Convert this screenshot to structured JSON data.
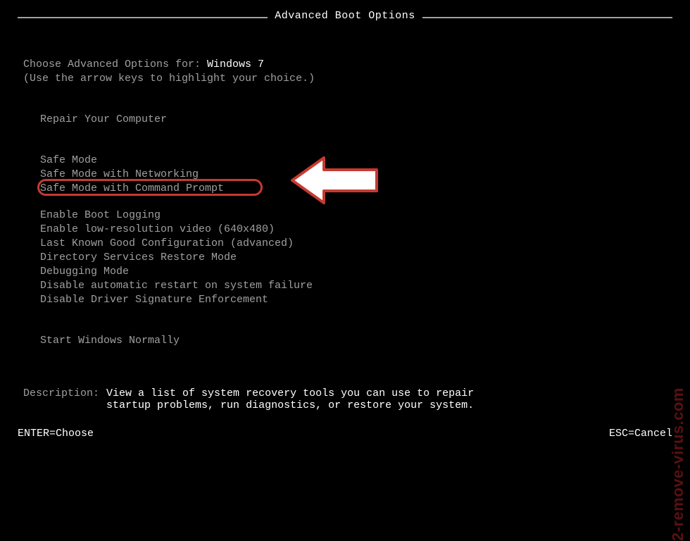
{
  "title": "Advanced Boot Options",
  "header": {
    "choose_label": "Choose Advanced Options for: ",
    "os_name": "Windows 7",
    "instructions": "(Use the arrow keys to highlight your choice.)"
  },
  "menu": {
    "repair": "Repair Your Computer",
    "safe_mode": "Safe Mode",
    "safe_mode_net": "Safe Mode with Networking",
    "safe_mode_cmd": "Safe Mode with Command Prompt",
    "boot_logging": "Enable Boot Logging",
    "low_res": "Enable low-resolution video (640x480)",
    "last_known": "Last Known Good Configuration (advanced)",
    "ds_restore": "Directory Services Restore Mode",
    "debugging": "Debugging Mode",
    "disable_restart": "Disable automatic restart on system failure",
    "disable_sig": "Disable Driver Signature Enforcement",
    "start_normal": "Start Windows Normally"
  },
  "description": {
    "label": "Description:   ",
    "text": "View a list of system recovery tools you can use to repair startup problems, run diagnostics, or restore your system."
  },
  "footer": {
    "enter": "ENTER=Choose",
    "esc": "ESC=Cancel"
  },
  "watermark": "2-remove-virus.com",
  "colors": {
    "highlight_border": "#c63a30"
  }
}
